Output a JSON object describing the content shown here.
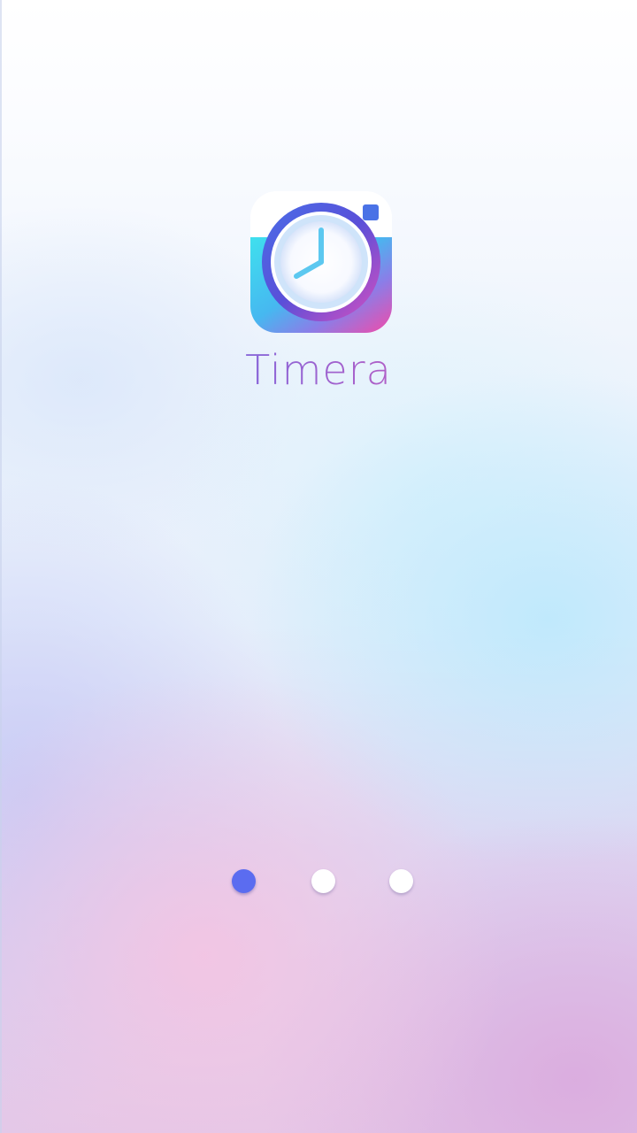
{
  "app": {
    "name": "Timera",
    "icon": "clock-camera-icon"
  },
  "pager": {
    "page_count": 3,
    "active_index": 0,
    "active_color": "#5b6cf0",
    "inactive_color": "#ffffff"
  },
  "colors": {
    "brand_blue": "#5b74e8",
    "brand_purple": "#8a66d8",
    "brand_pink": "#ee5aa0",
    "brand_cyan": "#4fd6ec"
  }
}
